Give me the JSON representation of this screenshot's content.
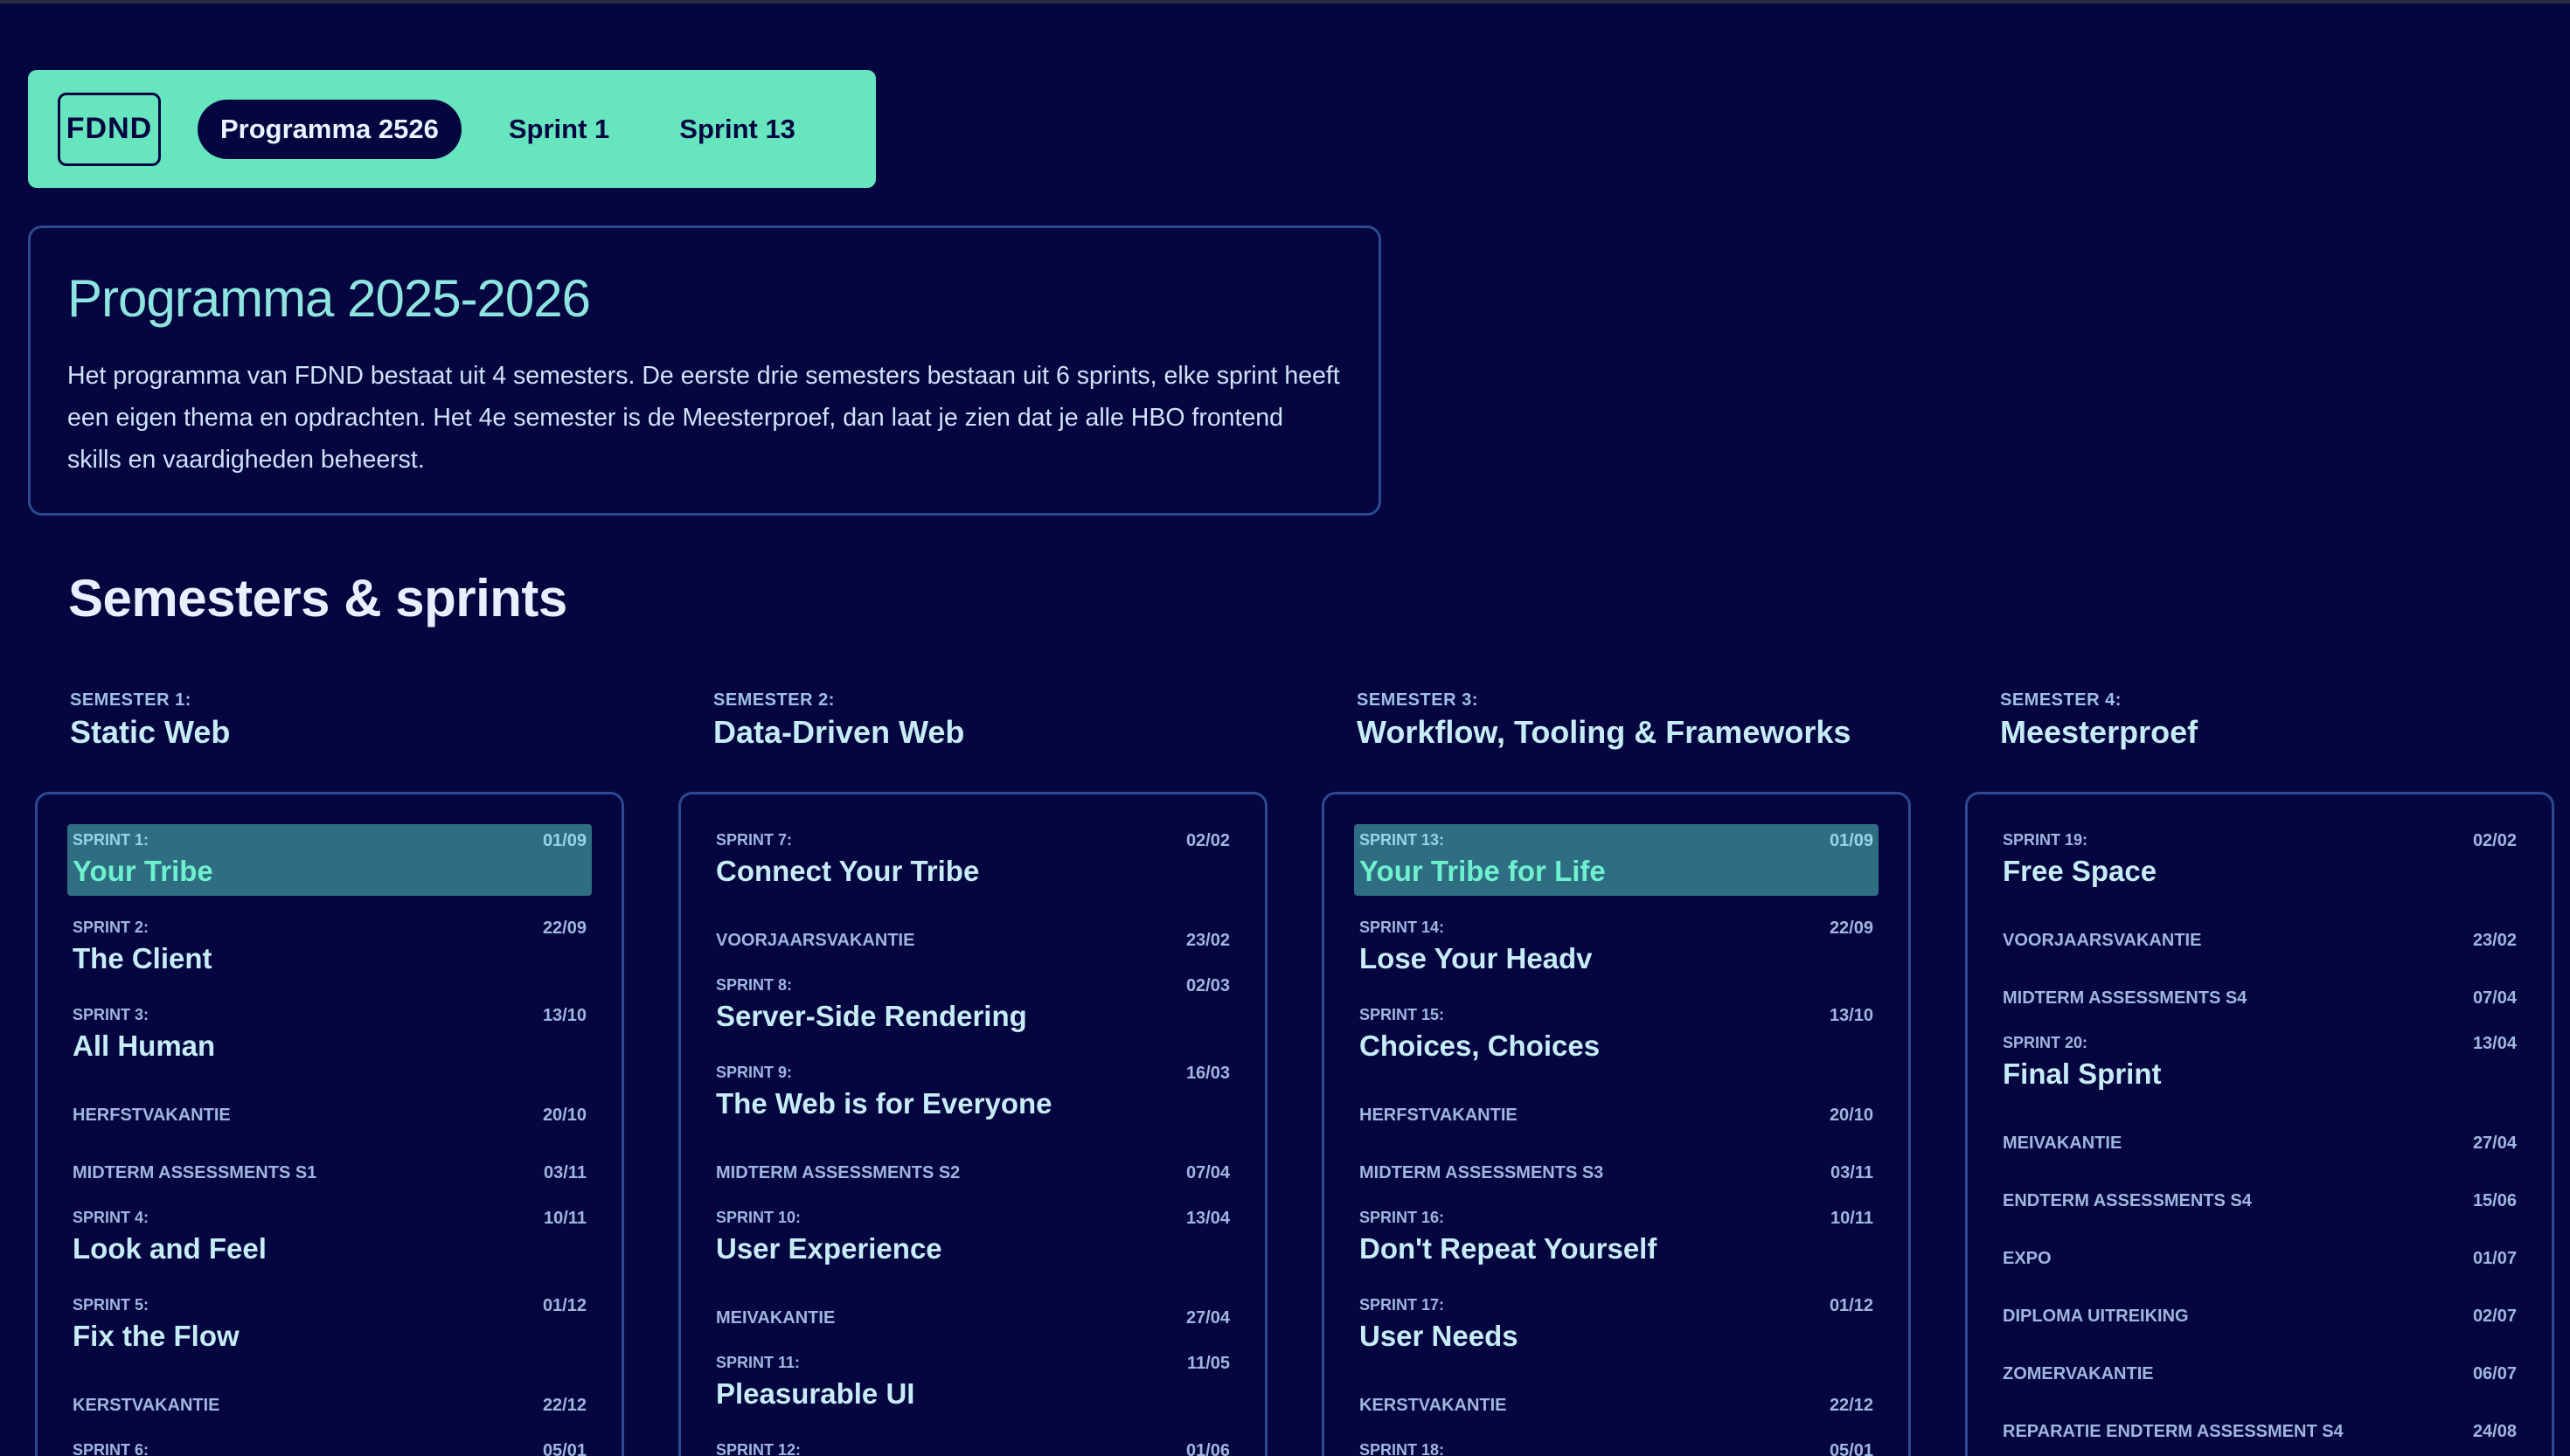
{
  "nav": {
    "logo": "FDND",
    "links": [
      "Programma 2526",
      "Sprint 1",
      "Sprint 13"
    ]
  },
  "intro": {
    "title": "Programma 2025-2026",
    "text": "Het programma van FDND bestaat uit 4 semesters. De eerste drie semesters bestaan uit 6 sprints, elke sprint heeft een eigen thema en opdrachten. Het 4e semester is de Meesterproef, dan laat je zien dat je alle HBO frontend skills en vaardigheden beheerst."
  },
  "section_title": "Semesters & sprints",
  "semesters": [
    {
      "label": "Semester 1:",
      "title": "Static Web",
      "items": [
        {
          "kind": "sprint",
          "label": "Sprint 1:",
          "title": "Your Tribe",
          "date": "01/09",
          "highlight": true
        },
        {
          "kind": "sprint",
          "label": "Sprint 2:",
          "title": "The Client",
          "date": "22/09"
        },
        {
          "kind": "sprint",
          "label": "Sprint 3:",
          "title": "All Human",
          "date": "13/10"
        },
        {
          "kind": "event",
          "label": "Herfstvakantie",
          "date": "20/10"
        },
        {
          "kind": "event",
          "label": "Midterm Assessments S1",
          "date": "03/11"
        },
        {
          "kind": "sprint",
          "label": "Sprint 4:",
          "title": "Look and Feel",
          "date": "10/11"
        },
        {
          "kind": "sprint",
          "label": "Sprint 5:",
          "title": "Fix the Flow",
          "date": "01/12"
        },
        {
          "kind": "event",
          "label": "Kerstvakantie",
          "date": "22/12"
        },
        {
          "kind": "sprint",
          "label": "Sprint 6:",
          "title": "",
          "date": "05/01"
        }
      ]
    },
    {
      "label": "Semester 2:",
      "title": "Data-Driven Web",
      "items": [
        {
          "kind": "sprint",
          "label": "Sprint 7:",
          "title": "Connect Your Tribe",
          "date": "02/02"
        },
        {
          "kind": "event",
          "label": "Voorjaarsvakantie",
          "date": "23/02"
        },
        {
          "kind": "sprint",
          "label": "Sprint 8:",
          "title": "Server-Side Rendering",
          "date": "02/03"
        },
        {
          "kind": "sprint",
          "label": "Sprint 9:",
          "title": "The Web is for Everyone",
          "date": "16/03"
        },
        {
          "kind": "event",
          "label": "Midterm Assessments S2",
          "date": "07/04"
        },
        {
          "kind": "sprint",
          "label": "Sprint 10:",
          "title": "User Experience",
          "date": "13/04"
        },
        {
          "kind": "event",
          "label": "Meivakantie",
          "date": "27/04"
        },
        {
          "kind": "sprint",
          "label": "Sprint 11:",
          "title": "Pleasurable UI",
          "date": "11/05"
        },
        {
          "kind": "sprint",
          "label": "Sprint 12:",
          "title": "",
          "date": "01/06"
        }
      ]
    },
    {
      "label": "Semester 3:",
      "title": "Workflow, Tooling & Frameworks",
      "items": [
        {
          "kind": "sprint",
          "label": "Sprint 13:",
          "title": "Your Tribe for Life",
          "date": "01/09",
          "highlight": true
        },
        {
          "kind": "sprint",
          "label": "Sprint 14:",
          "title": "Lose Your Headv",
          "date": "22/09"
        },
        {
          "kind": "sprint",
          "label": "Sprint 15:",
          "title": "Choices, Choices",
          "date": "13/10"
        },
        {
          "kind": "event",
          "label": "Herfstvakantie",
          "date": "20/10"
        },
        {
          "kind": "event",
          "label": "Midterm Assessments S3",
          "date": "03/11"
        },
        {
          "kind": "sprint",
          "label": "Sprint 16:",
          "title": "Don't Repeat Yourself",
          "date": "10/11"
        },
        {
          "kind": "sprint",
          "label": "Sprint 17:",
          "title": "User Needs",
          "date": "01/12"
        },
        {
          "kind": "event",
          "label": "Kerstvakantie",
          "date": "22/12"
        },
        {
          "kind": "sprint",
          "label": "Sprint 18:",
          "title": "",
          "date": "05/01"
        }
      ]
    },
    {
      "label": "Semester 4:",
      "title": "Meesterproef",
      "items": [
        {
          "kind": "sprint",
          "label": "Sprint 19:",
          "title": "Free Space",
          "date": "02/02"
        },
        {
          "kind": "event",
          "label": "Voorjaarsvakantie",
          "date": "23/02"
        },
        {
          "kind": "event",
          "label": "Midterm Assessments S4",
          "date": "07/04"
        },
        {
          "kind": "sprint",
          "label": "Sprint 20:",
          "title": "Final Sprint",
          "date": "13/04"
        },
        {
          "kind": "event",
          "label": "Meivakantie",
          "date": "27/04"
        },
        {
          "kind": "event",
          "label": "Endterm Assessments S4",
          "date": "15/06"
        },
        {
          "kind": "event",
          "label": "Expo",
          "date": "01/07"
        },
        {
          "kind": "event",
          "label": "Diploma uitreiking",
          "date": "02/07"
        },
        {
          "kind": "event",
          "label": "Zomervakantie",
          "date": "06/07"
        },
        {
          "kind": "event",
          "label": "Reparatie Endterm Assessment S4",
          "date": "24/08"
        }
      ]
    }
  ]
}
